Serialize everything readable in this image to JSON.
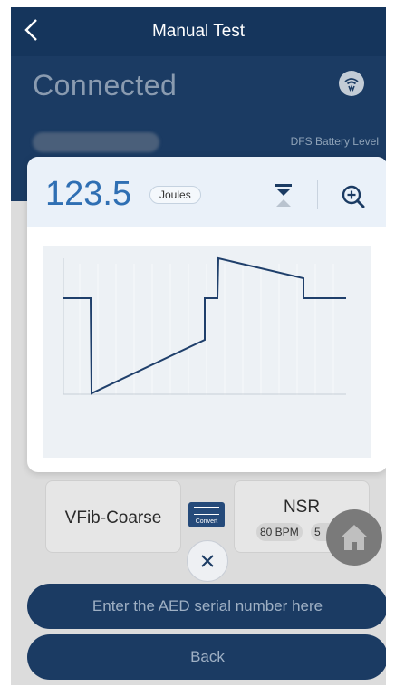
{
  "header": {
    "title": "Manual Test"
  },
  "status": {
    "connection": "Connected",
    "battery_label": "DFS Battery Level"
  },
  "modal": {
    "energy_value": "123.5",
    "energy_unit": "Joules",
    "icons": {
      "sort": "sort-arrows-icon",
      "zoom": "zoom-in-icon"
    }
  },
  "rhythms": {
    "left": {
      "label": "VFib-Coarse"
    },
    "convert": {
      "label": "Convert"
    },
    "right": {
      "label": "NSR",
      "bpm": "80 BPM",
      "extra": "5"
    }
  },
  "buttons": {
    "serial": "Enter the AED serial number here",
    "back": "Back"
  },
  "colors": {
    "header_bg": "#15355c",
    "accent_blue": "#2f6fb3",
    "waveform": "#1f3f6b",
    "button_bg": "#1b3b63"
  }
}
